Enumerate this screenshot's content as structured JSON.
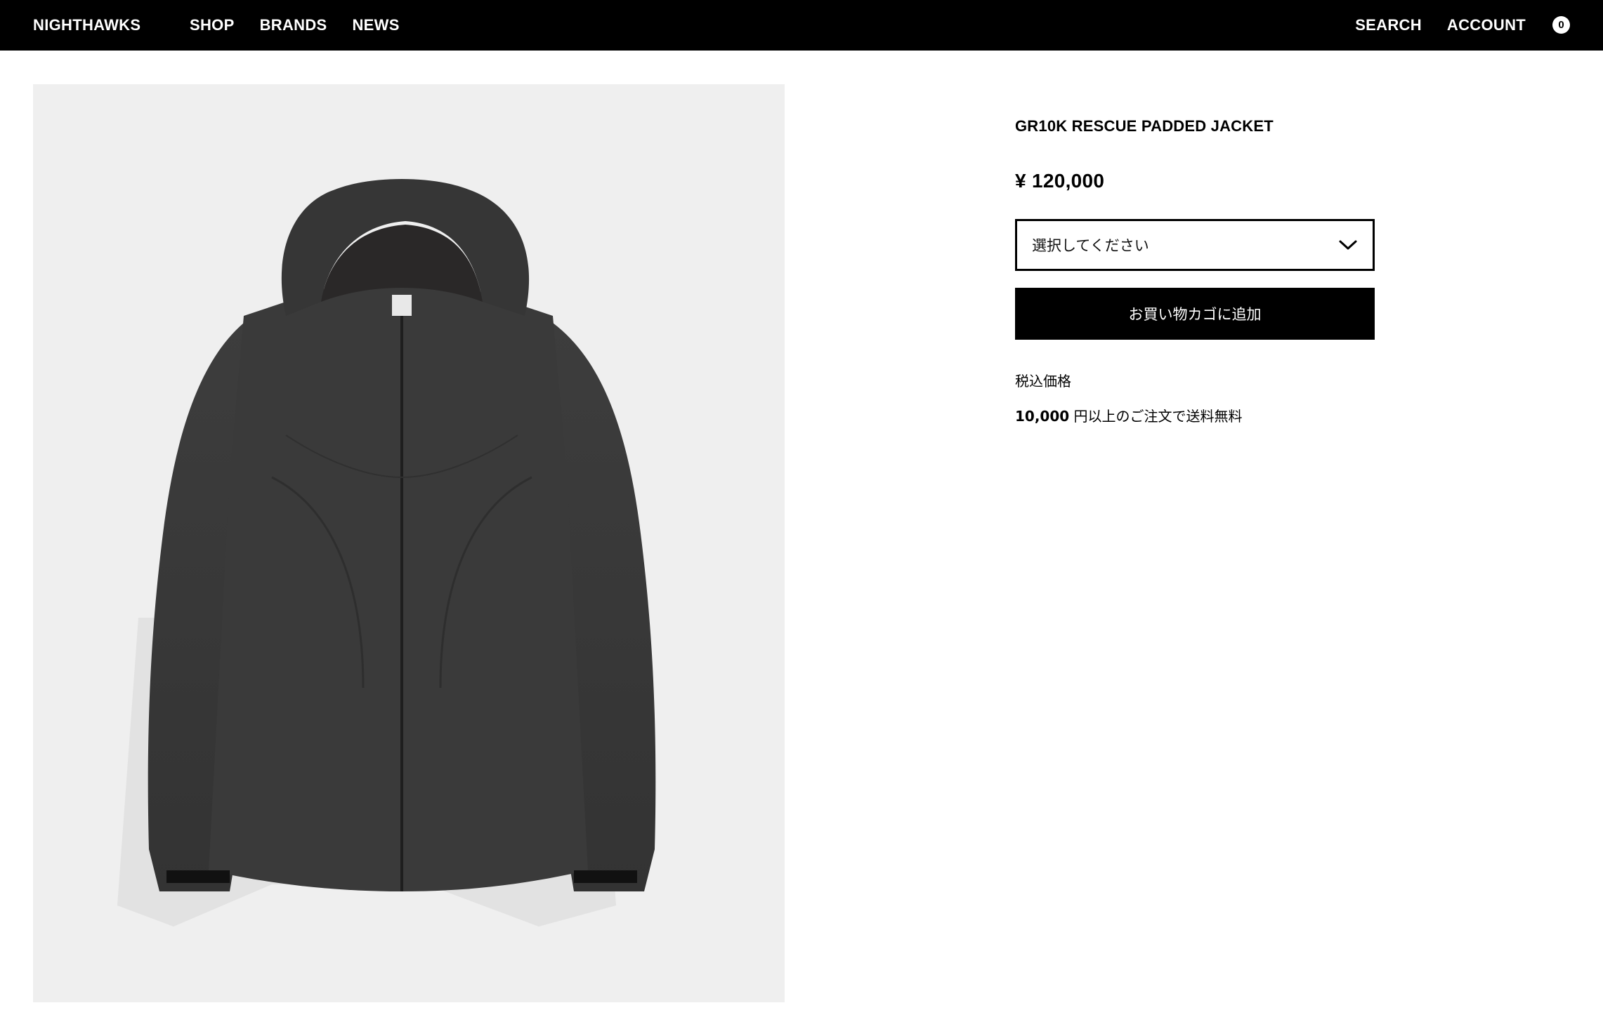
{
  "header": {
    "brand": "NIGHTHAWKS",
    "nav_left": [
      {
        "label": "SHOP"
      },
      {
        "label": "BRANDS"
      },
      {
        "label": "NEWS"
      }
    ],
    "nav_right": [
      {
        "label": "SEARCH"
      },
      {
        "label": "ACCOUNT"
      }
    ],
    "cart_count": "0"
  },
  "product": {
    "title": "GR10K RESCUE PADDED JACKET",
    "price": "¥ 120,000",
    "image_icon": "hooded-jacket-image",
    "colors": {
      "jacket": "#3a3a3a",
      "image_background": "#efefef"
    }
  },
  "purchase": {
    "select_placeholder": "選択してください",
    "add_to_cart_label": "お買い物カゴに追加"
  },
  "notes": {
    "tax": "税込価格",
    "shipping_amount": "10,000",
    "shipping_text": " 円以上のご注文で送料無料"
  }
}
